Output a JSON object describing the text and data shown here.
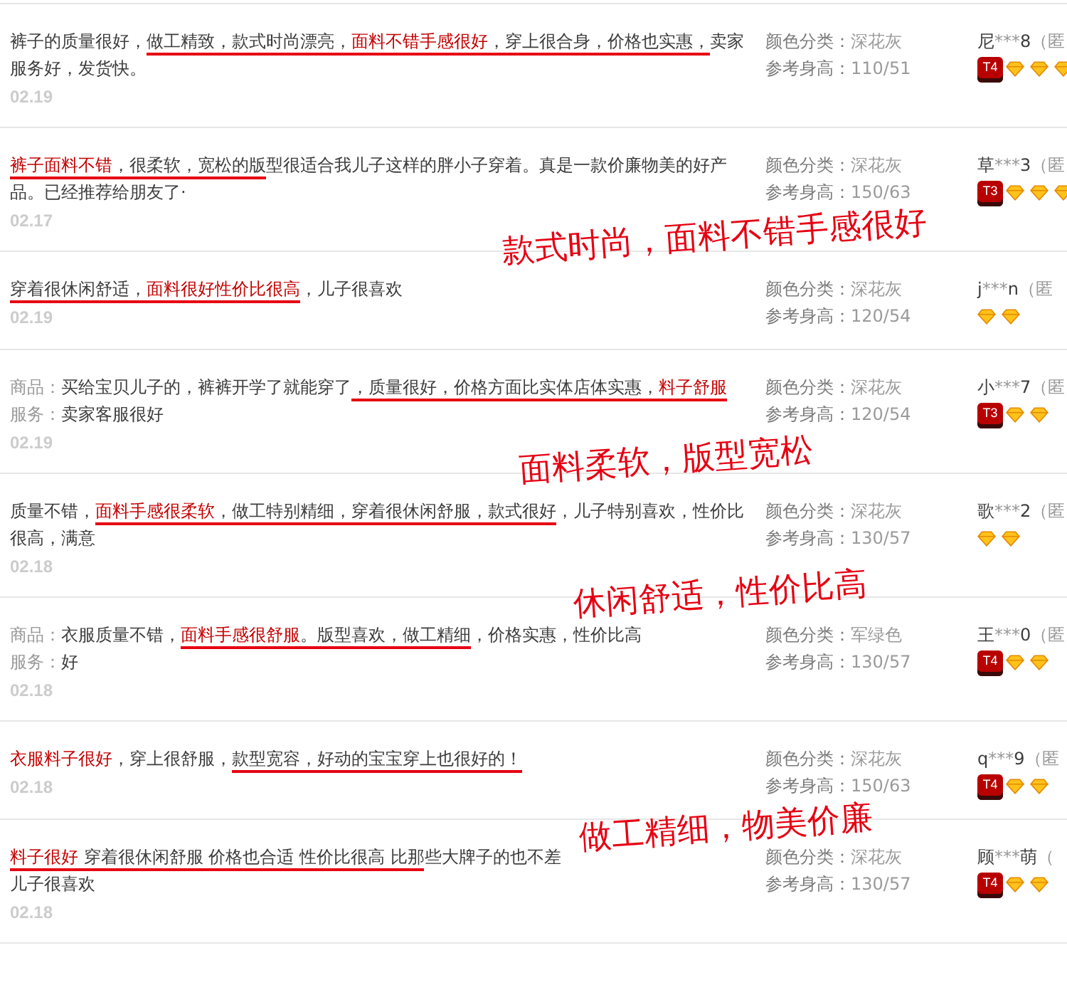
{
  "reviews": [
    {
      "lines": [
        {
          "segments": [
            {
              "text": "裤子的质量很好，",
              "red": false,
              "underlined": false
            },
            {
              "text": "做工精致，款式时尚漂亮，",
              "red": false,
              "underlined": true
            },
            {
              "text": "面料不错手感很好",
              "red": true,
              "underlined": true
            },
            {
              "text": "，穿上很合身，价格也实惠，",
              "red": false,
              "underlined": true
            },
            {
              "text": "卖家服务好，发货快。",
              "red": false,
              "underlined": false
            }
          ]
        }
      ],
      "date": "02.19",
      "sku": [
        {
          "label": "颜色分类：",
          "value": "深花灰"
        },
        {
          "label": "参考身高：",
          "value": "110/51"
        }
      ],
      "user": {
        "first": "尼",
        "mask": "***",
        "last": "8",
        "anon": "（匿",
        "badge": "T4",
        "kind": "diamond3"
      }
    },
    {
      "lines": [
        {
          "segments": [
            {
              "text": "裤子面料不错",
              "red": true,
              "underlined": true
            },
            {
              "text": "，很柔软，宽松的版",
              "red": false,
              "underlined": true
            },
            {
              "text": "型很适合我儿子这样的胖小子穿着。真是一款价廉物美的好产品。已经推荐给朋友了·",
              "red": false,
              "underlined": false
            }
          ]
        }
      ],
      "date": "02.17",
      "sku": [
        {
          "label": "颜色分类：",
          "value": "深花灰"
        },
        {
          "label": "参考身高：",
          "value": "150/63"
        }
      ],
      "user": {
        "first": "草",
        "mask": "***",
        "last": "3",
        "anon": "（匿",
        "badge": "T3",
        "kind": "diamond3"
      }
    },
    {
      "lines": [
        {
          "segments": [
            {
              "text": "穿着很休闲舒适，",
              "red": false,
              "underlined": true
            },
            {
              "text": "面料很好性价比很高",
              "red": true,
              "underlined": true
            },
            {
              "text": "，儿子很喜欢",
              "red": false,
              "underlined": false
            }
          ]
        }
      ],
      "date": "02.19",
      "sku": [
        {
          "label": "颜色分类：",
          "value": "深花灰"
        },
        {
          "label": "参考身高：",
          "value": "120/54"
        }
      ],
      "user": {
        "first": "j",
        "mask": "***",
        "last": "n",
        "anon": "（匿",
        "kind": "diamond2"
      }
    },
    {
      "lines": [
        {
          "label": "商品：",
          "segments": [
            {
              "text": "买给宝贝儿子的，裤裤开学了就能穿了",
              "red": false,
              "underlined": false
            },
            {
              "text": "，质量很好，价格方面比实体店体实惠，",
              "red": false,
              "underlined": true
            },
            {
              "text": "料子舒服",
              "red": true,
              "underlined": true
            }
          ]
        },
        {
          "label": "服务：",
          "segments": [
            {
              "text": "卖家客服很好",
              "red": false,
              "underlined": false
            }
          ]
        }
      ],
      "date": "02.19",
      "sku": [
        {
          "label": "颜色分类：",
          "value": "深花灰"
        },
        {
          "label": "参考身高：",
          "value": "120/54"
        }
      ],
      "user": {
        "first": "小",
        "mask": "***",
        "last": "7",
        "anon": "（匿",
        "badge": "T3",
        "kind": "diamond2"
      }
    },
    {
      "lines": [
        {
          "segments": [
            {
              "text": "质量不错，",
              "red": false,
              "underlined": false
            },
            {
              "text": "面料手感很柔软",
              "red": true,
              "underlined": true
            },
            {
              "text": "，做工特别精细，穿着很休闲舒服，款式很好",
              "red": false,
              "underlined": true
            },
            {
              "text": "，儿子特别喜欢，性价比很高，满意",
              "red": false,
              "underlined": false
            }
          ]
        }
      ],
      "date": "02.18",
      "sku": [
        {
          "label": "颜色分类：",
          "value": "深花灰"
        },
        {
          "label": "参考身高：",
          "value": "130/57"
        }
      ],
      "user": {
        "first": "歌",
        "mask": "***",
        "last": "2",
        "anon": "（匿",
        "kind": "diamond2"
      }
    },
    {
      "lines": [
        {
          "label": "商品：",
          "segments": [
            {
              "text": "衣服质量不错，",
              "red": false,
              "underlined": false
            },
            {
              "text": "面料手感很舒服",
              "red": true,
              "underlined": true
            },
            {
              "text": "。版型喜欢，做工精细",
              "red": false,
              "underlined": true
            },
            {
              "text": "，价格实惠，性价比高",
              "red": false,
              "underlined": false
            }
          ]
        },
        {
          "label": "服务：",
          "segments": [
            {
              "text": "好",
              "red": false,
              "underlined": false
            }
          ]
        }
      ],
      "date": "02.18",
      "sku": [
        {
          "label": "颜色分类：",
          "value": "军绿色"
        },
        {
          "label": "参考身高：",
          "value": "130/57"
        }
      ],
      "user": {
        "first": "王",
        "mask": "***",
        "last": "0",
        "anon": "（匿",
        "badge": "T4",
        "kind": "diamond2"
      }
    },
    {
      "lines": [
        {
          "segments": [
            {
              "text": "衣服料子很好",
              "red": true,
              "underlined": false
            },
            {
              "text": "，穿上很舒服，",
              "red": false,
              "underlined": false
            },
            {
              "text": "款型宽容，好动的宝宝穿上也很好的！",
              "red": false,
              "underlined": true
            }
          ]
        }
      ],
      "date": "02.18",
      "sku": [
        {
          "label": "颜色分类：",
          "value": "深花灰"
        },
        {
          "label": "参考身高：",
          "value": "150/63"
        }
      ],
      "user": {
        "first": "q",
        "mask": "***",
        "last": "9",
        "anon": "（匿",
        "badge": "T4",
        "kind": "diamond2"
      }
    },
    {
      "lines": [
        {
          "segments": [
            {
              "text": "料子很好",
              "red": true,
              "underlined": true
            },
            {
              "text": " 穿着很休闲舒服 价格也合适 性价比很高 比那",
              "red": false,
              "underlined": true
            },
            {
              "text": "些大牌子的也不差",
              "red": false,
              "underlined": false
            }
          ]
        },
        {
          "segments": [
            {
              "text": "儿子很喜欢",
              "red": false,
              "underlined": false
            }
          ]
        }
      ],
      "date": "02.18",
      "sku": [
        {
          "label": "颜色分类：",
          "value": "深花灰"
        },
        {
          "label": "参考身高：",
          "value": "130/57"
        }
      ],
      "user": {
        "first": "顾",
        "mask": "***",
        "last": "萌",
        "anon": "（",
        "badge": "T4",
        "kind": "diamond2"
      }
    }
  ],
  "annotations": [
    "款式时尚，面料不错手感很好",
    "面料柔软，版型宽松",
    "休闲舒适，性价比高",
    "做工精细，物美价廉"
  ]
}
